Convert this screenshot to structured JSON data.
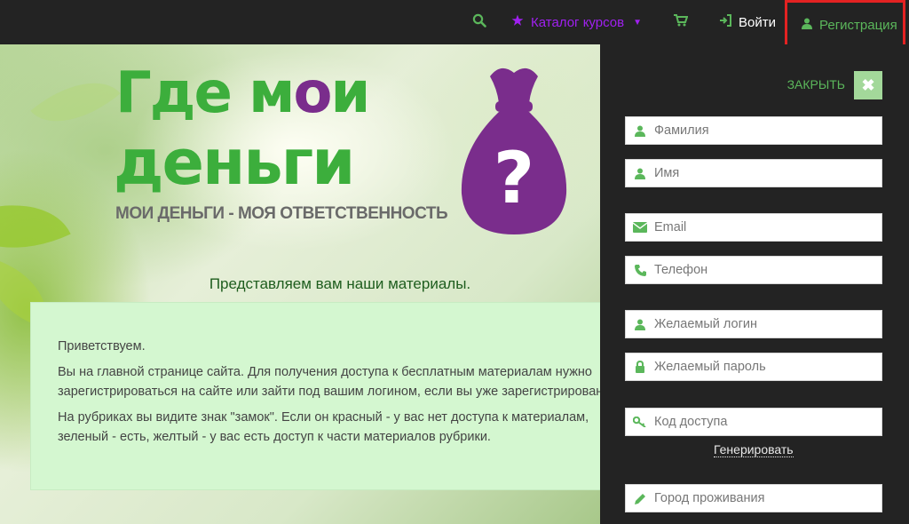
{
  "nav": {
    "search_icon": "search-icon",
    "catalog_label": "Каталог курсов",
    "cart_icon": "shopping-cart-icon",
    "login_label": "Войти",
    "register_label": "Регистрация"
  },
  "logo": {
    "line1_a": "Где м",
    "line1_b": "и",
    "line2": "деньги",
    "tagline": "МОИ ДЕНЬГИ - МОЯ ОТВЕТСТВЕННОСТЬ"
  },
  "hero": {
    "subtitle": "Представляем вам наши материалы."
  },
  "welcome": {
    "greeting": "Приветствуем.",
    "paragraph1_line1": "Вы на главной странице сайта. Для получения доступа к бесплатным материалам нужно",
    "paragraph1_line2": "зарегистрироваться на сайте или зайти под вашим логином, если вы уже зарегистрированы",
    "paragraph2_line1": "На рубриках  вы видите знак \"замок\". Если он красный  - у вас нет доступа к материалам,",
    "paragraph2_line2": "зеленый - есть, желтый  - у вас есть доступ к части материалов рубрики."
  },
  "panel": {
    "close_label": "ЗАКРЫТЬ",
    "close_icon": "✖",
    "generate_label": "Генерировать",
    "fields": [
      {
        "placeholder": "Фамилия",
        "icon": "user-icon"
      },
      {
        "placeholder": "Имя",
        "icon": "user-icon"
      },
      {
        "placeholder": "Email",
        "icon": "envelope-icon"
      },
      {
        "placeholder": "Телефон",
        "icon": "phone-icon"
      },
      {
        "placeholder": "Желаемый логин",
        "icon": "user-icon"
      },
      {
        "placeholder": "Желаемый пароль",
        "icon": "lock-icon"
      },
      {
        "placeholder": "Код доступа",
        "icon": "key-icon"
      },
      {
        "placeholder": "Город проживания",
        "icon": "pencil-icon"
      }
    ]
  },
  "colors": {
    "accent_green": "#5bb75b",
    "catalog_purple": "#a020f0",
    "highlight_red": "#e32222",
    "panel_bg": "#232323",
    "box_bg": "#d4f7d0"
  }
}
